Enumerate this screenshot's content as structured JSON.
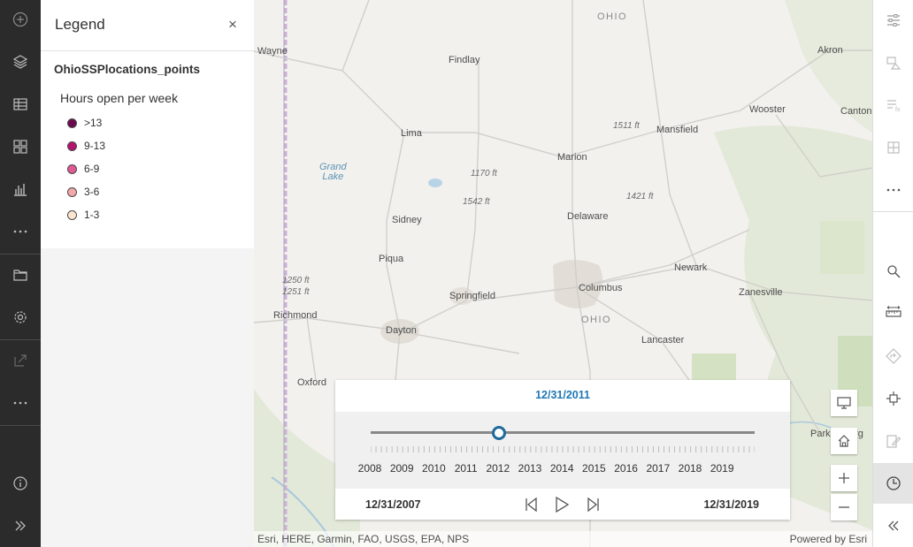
{
  "left_toolbar": {
    "icons": [
      "add-icon",
      "layers-icon",
      "table-icon",
      "basemap-gallery-icon",
      "chart-icon",
      "more-icon",
      "folder-icon",
      "settings-icon",
      "share-icon",
      "more-icon",
      "info-icon",
      "expand-icon"
    ]
  },
  "legend": {
    "title": "Legend",
    "close": "×",
    "layer_name": "OhioSSPlocations_points",
    "field_name": "Hours open per week",
    "items": [
      {
        "label": ">13",
        "color": "#6b0a4e"
      },
      {
        "label": "9-13",
        "color": "#b4146e"
      },
      {
        "label": "6-9",
        "color": "#e05a93"
      },
      {
        "label": "3-6",
        "color": "#f4a8a8"
      },
      {
        "label": "1-3",
        "color": "#fde6cf"
      }
    ]
  },
  "map": {
    "cities": [
      {
        "name": "Wayne"
      },
      {
        "name": "Findlay"
      },
      {
        "name": "Akron"
      },
      {
        "name": "Wooster"
      },
      {
        "name": "Canton"
      },
      {
        "name": "Mansfield"
      },
      {
        "name": "Lima"
      },
      {
        "name": "Marion"
      },
      {
        "name": "Sidney"
      },
      {
        "name": "Delaware"
      },
      {
        "name": "Piqua"
      },
      {
        "name": "Newark"
      },
      {
        "name": "Columbus"
      },
      {
        "name": "Zanesville"
      },
      {
        "name": "Springfield"
      },
      {
        "name": "Richmond"
      },
      {
        "name": "Dayton"
      },
      {
        "name": "Lancaster"
      },
      {
        "name": "Oxford"
      },
      {
        "name": "Parkersburg"
      }
    ],
    "states": [
      "OHIO",
      "OHIO"
    ],
    "elevations": [
      "1511 ft",
      "1170 ft",
      "1542 ft",
      "1421 ft",
      "1250 ft",
      "1251 ft"
    ],
    "water_label": "Grand\nLake",
    "attribution_left": "Esri, HERE, Garmin, FAO, USGS, EPA, NPS",
    "attribution_right": "Powered by Esri"
  },
  "time_slider": {
    "current": "12/31/2011",
    "years": [
      "2008",
      "2009",
      "2010",
      "2011",
      "2012",
      "2013",
      "2014",
      "2015",
      "2016",
      "2017",
      "2018",
      "2019"
    ],
    "start": "12/31/2007",
    "end": "12/31/2019",
    "position_fraction": 0.333
  },
  "map_buttons": [
    "monitor-icon",
    "home-icon",
    "zoom-in-icon",
    "zoom-out-icon"
  ],
  "right_toolbar": {
    "icons": [
      "filter-icon",
      "style-icon",
      "configure-popup-icon",
      "cluster-icon",
      "more-icon",
      "search-icon",
      "measure-icon",
      "directions-icon",
      "location-icon",
      "sketch-icon",
      "time-icon",
      "collapse-icon"
    ]
  },
  "colors": {
    "accent": "#1f78b4",
    "dark_toolbar": "#2b2b2b"
  }
}
